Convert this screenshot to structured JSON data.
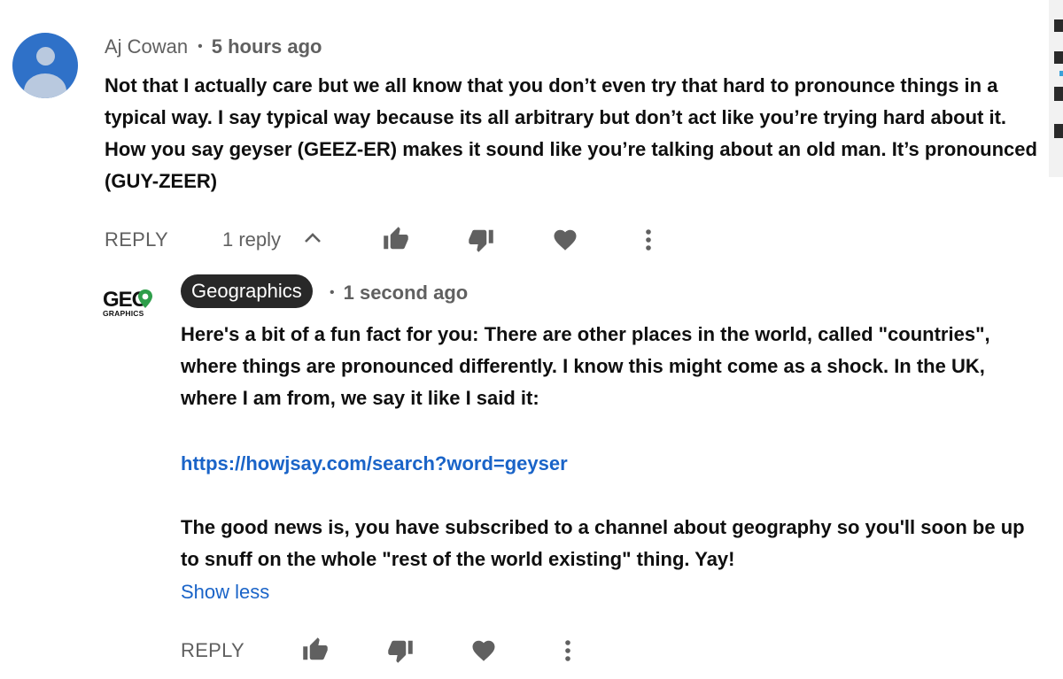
{
  "comment": {
    "author": "Aj Cowan",
    "separator": "•",
    "time": "5 hours ago",
    "text": "Not that I actually care but we all know that you don’t even try that hard to pronounce things in a typical way. I say typical way because its all arbitrary but don’t act like you’re trying hard about it. How you say geyser (GEEZ-ER) makes it sound like you’re talking about an old man. It’s pronounced (GUY-ZEER)",
    "reply_label": "REPLY",
    "replies_label": "1 reply",
    "icons": {
      "avatar": "default-avatar-icon",
      "expand": "chevron-up-icon",
      "like": "thumbs-up-icon",
      "dislike": "thumbs-down-icon",
      "heart": "heart-icon",
      "more": "more-vert-icon"
    }
  },
  "reply": {
    "author": "Geographics",
    "separator": "•",
    "time": "1 second ago",
    "logo_text": "GEO",
    "logo_subtext": "GRAPHICS",
    "paragraph1": "Here's a bit of a fun fact for you: There are other places in the world, called \"countries\", where things are pronounced differently. I know this might come as a shock. In the UK, where I am from, we say it like I said it:",
    "link": "https://howjsay.com/search?word=geyser",
    "paragraph2": "The good news is, you have subscribed to a channel about geography so you'll soon be up to snuff on the whole \"rest of the world existing\" thing. Yay!",
    "show_less_label": "Show less",
    "reply_label": "REPLY",
    "colors": {
      "pill_background": "#282828",
      "link": "#1a64c8",
      "logo_pin": "#2e9e4a"
    }
  },
  "colors": {
    "avatar": "#2f71c8",
    "secondary_text": "#606060",
    "primary_text": "#0f0f0f"
  }
}
